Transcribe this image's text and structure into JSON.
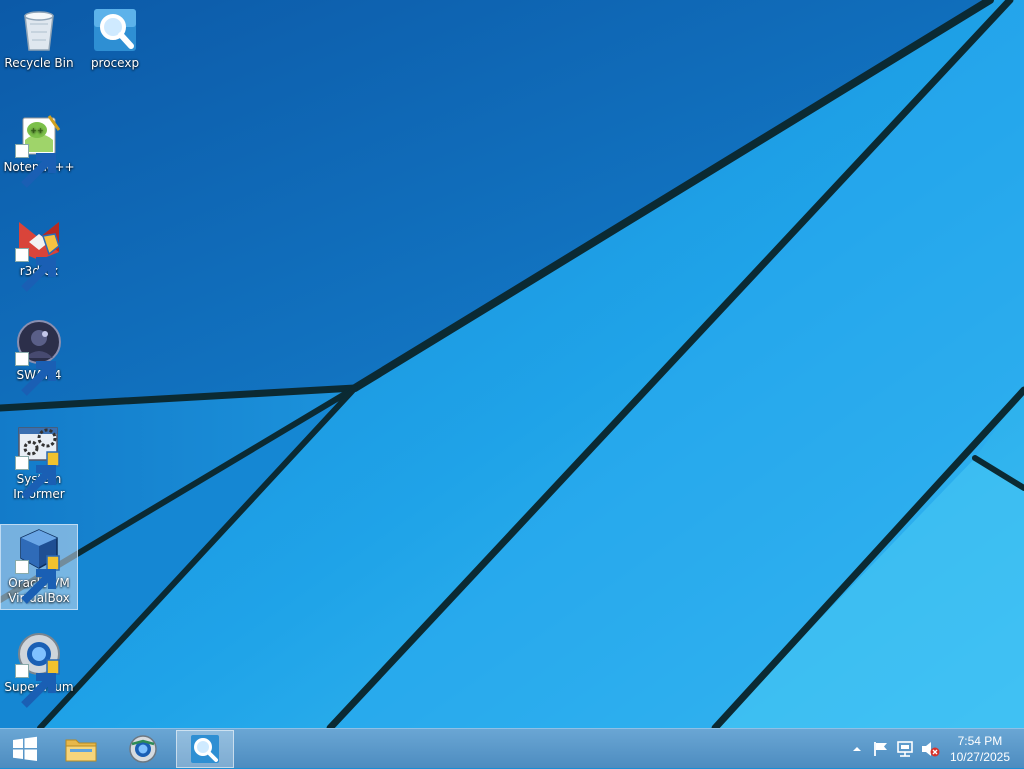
{
  "desktop": {
    "icons": [
      {
        "label": "Recycle Bin",
        "icon": "recycle-bin-icon"
      },
      {
        "label": "procexp",
        "icon": "procexp-icon"
      },
      {
        "label": "Notepad++",
        "icon": "notepad-plus-plus-icon"
      },
      {
        "label": "r3dfox",
        "icon": "r3dfox-icon"
      },
      {
        "label": "SWAT 4",
        "icon": "swat4-icon"
      },
      {
        "label": "System Informer",
        "icon": "system-informer-icon"
      },
      {
        "label": "Oracle VM VirtualBox",
        "icon": "virtualbox-icon",
        "selected": true
      },
      {
        "label": "Supermium",
        "icon": "supermium-icon"
      }
    ]
  },
  "taskbar": {
    "start": {
      "icon": "windows-logo-icon"
    },
    "pinned": [
      {
        "name": "File Explorer",
        "icon": "folder-icon"
      },
      {
        "name": "Supermium",
        "icon": "supermium-icon"
      },
      {
        "name": "procexp",
        "icon": "procexp-icon",
        "active": true
      }
    ],
    "tray": {
      "icons": [
        "show-hidden-icons-chevron",
        "action-center-flag-icon",
        "network-icon",
        "volume-muted-icon"
      ]
    },
    "clock": {
      "time": "7:54 PM",
      "date": "10/27/2025"
    }
  },
  "colors": {
    "wallpaper_light": "#38b6f0",
    "wallpaper_dark": "#0f5fb0",
    "taskbar": "#5b98c9"
  }
}
